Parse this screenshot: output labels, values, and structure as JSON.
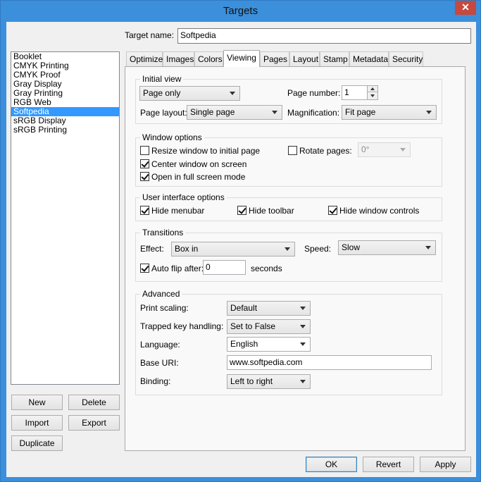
{
  "window": {
    "title": "Targets",
    "close_glyph": "✕"
  },
  "target_name": {
    "label": "Target name:",
    "value": "Softpedia"
  },
  "targets": [
    "Booklet",
    "CMYK Printing",
    "CMYK Proof",
    "Gray Display",
    "Gray Printing",
    "RGB Web",
    "Softpedia",
    "sRGB Display",
    "sRGB Printing"
  ],
  "selected_target": "Softpedia",
  "list_buttons": {
    "new": "New",
    "delete": "Delete",
    "import": "Import",
    "export": "Export",
    "duplicate": "Duplicate"
  },
  "tabs": [
    "Optimize",
    "Images",
    "Colors",
    "Viewing",
    "Pages",
    "Layout",
    "Stamp",
    "Metadata",
    "Security"
  ],
  "active_tab": "Viewing",
  "initial_view": {
    "title": "Initial view",
    "page_mode": "Page only",
    "page_number_label": "Page number:",
    "page_number": "1",
    "page_layout_label": "Page layout:",
    "page_layout": "Single page",
    "magnification_label": "Magnification:",
    "magnification": "Fit page"
  },
  "window_options": {
    "title": "Window options",
    "resize_label": "Resize window to initial page",
    "resize_checked": false,
    "center_label": "Center window on screen",
    "center_checked": true,
    "fullscreen_label": "Open in full screen mode",
    "fullscreen_checked": true,
    "rotate_label": "Rotate pages:",
    "rotate_checked": false,
    "rotate_value": "0°"
  },
  "ui_options": {
    "title": "User interface options",
    "hide_menubar": "Hide menubar",
    "hide_toolbar": "Hide toolbar",
    "hide_window_controls": "Hide window controls"
  },
  "transitions": {
    "title": "Transitions",
    "effect_label": "Effect:",
    "effect": "Box in",
    "speed_label": "Speed:",
    "speed": "Slow",
    "auto_flip_label": "Auto flip after:",
    "auto_flip_value": "0",
    "seconds_label": "seconds"
  },
  "advanced": {
    "title": "Advanced",
    "print_scaling_label": "Print scaling:",
    "print_scaling": "Default",
    "trapped_label": "Trapped key handling:",
    "trapped": "Set to False",
    "language_label": "Language:",
    "language": "English",
    "base_uri_label": "Base URI:",
    "base_uri": "www.softpedia.com",
    "binding_label": "Binding:",
    "binding": "Left to right"
  },
  "footer": {
    "ok": "OK",
    "revert": "Revert",
    "apply": "Apply"
  },
  "colors": {
    "titlebar": "#3c8fda",
    "close": "#c7483d",
    "selection": "#3399ff"
  }
}
